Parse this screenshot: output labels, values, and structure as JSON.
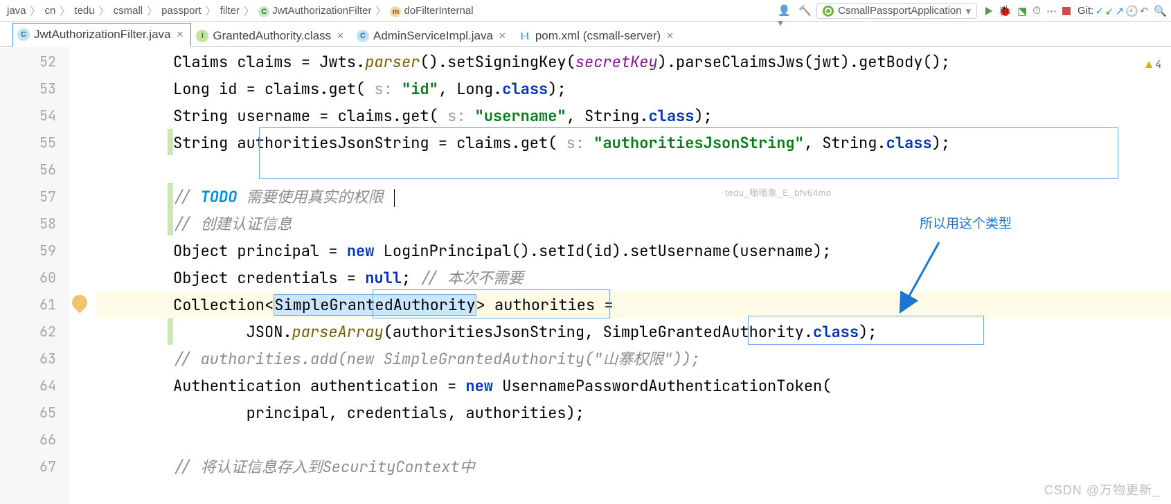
{
  "breadcrumbs": [
    "java",
    "cn",
    "tedu",
    "csmall",
    "passport",
    "filter",
    "JwtAuthorizationFilter",
    "doFilterInternal"
  ],
  "breadcrumb_icons": {
    "6": "C",
    "7": "m"
  },
  "run_config": "CsmallPassportApplication",
  "git_label": "Git:",
  "tabs": [
    {
      "icon": "C",
      "name": "JwtAuthorizationFilter.java",
      "active": true
    },
    {
      "icon": "I",
      "name": "GrantedAuthority.class",
      "active": false
    },
    {
      "icon": "C",
      "name": "AdminServiceImpl.java",
      "active": false
    },
    {
      "icon": "m",
      "name": "pom.xml (csmall-server)",
      "active": false
    }
  ],
  "warn_count": "4",
  "line_start": 52,
  "code_lines": [
    [
      {
        "t": "Claims claims = Jwts.",
        "c": "k-type"
      },
      {
        "t": "parser",
        "c": "k-method"
      },
      {
        "t": "().setSigningKey(",
        "c": "k-type"
      },
      {
        "t": "secretKey",
        "c": "k-field"
      },
      {
        "t": ").parseClaimsJws(jwt).getBody();",
        "c": "k-type"
      }
    ],
    [
      {
        "t": "Long id = claims.get(",
        "c": "k-type"
      },
      {
        "t": " s: ",
        "c": "k-param"
      },
      {
        "t": "\"id\"",
        "c": "k-str"
      },
      {
        "t": ", Long.",
        "c": "k-type"
      },
      {
        "t": "class",
        "c": "k-dotclass"
      },
      {
        "t": ");",
        "c": "k-type"
      }
    ],
    [
      {
        "t": "String username = claims.get(",
        "c": "k-type"
      },
      {
        "t": " s: ",
        "c": "k-param"
      },
      {
        "t": "\"username\"",
        "c": "k-str"
      },
      {
        "t": ", String.",
        "c": "k-type"
      },
      {
        "t": "class",
        "c": "k-dotclass"
      },
      {
        "t": ");",
        "c": "k-type"
      }
    ],
    [
      {
        "t": "String authoritiesJsonString = claims.get(",
        "c": "k-type"
      },
      {
        "t": " s: ",
        "c": "k-param"
      },
      {
        "t": "\"authoritiesJsonString\"",
        "c": "k-str"
      },
      {
        "t": ", String.",
        "c": "k-type"
      },
      {
        "t": "class",
        "c": "k-dotclass"
      },
      {
        "t": ");",
        "c": "k-type"
      }
    ],
    [],
    [
      {
        "t": "// ",
        "c": "k-comment"
      },
      {
        "t": "TODO",
        "c": "k-todo"
      },
      {
        "t": " 需要使用真实的权限",
        "c": "k-comment"
      }
    ],
    [
      {
        "t": "// 创建认证信息",
        "c": "k-comment"
      }
    ],
    [
      {
        "t": "Object principal = ",
        "c": "k-type"
      },
      {
        "t": "new",
        "c": "k-kw"
      },
      {
        "t": " LoginPrincipal().setId(id).setUsername(username);",
        "c": "k-type"
      }
    ],
    [
      {
        "t": "Object credentials = ",
        "c": "k-type"
      },
      {
        "t": "null",
        "c": "k-kw"
      },
      {
        "t": "; ",
        "c": "k-type"
      },
      {
        "t": "// 本次不需要",
        "c": "k-comment"
      }
    ],
    [
      {
        "t": "Collection<",
        "c": "k-type"
      },
      {
        "t": "SimpleGrantedAuthority",
        "c": "k-type sel"
      },
      {
        "t": "> authorities =",
        "c": "k-type"
      }
    ],
    [
      {
        "t": "        JSON.",
        "c": "k-type"
      },
      {
        "t": "parseArray",
        "c": "k-method"
      },
      {
        "t": "(authoritiesJsonString, ",
        "c": "k-type"
      },
      {
        "t": "SimpleGrantedAuthority",
        "c": "k-type"
      },
      {
        "t": ".",
        "c": "k-type"
      },
      {
        "t": "class",
        "c": "k-dotclass"
      },
      {
        "t": ");",
        "c": "k-type"
      }
    ],
    [
      {
        "t": "// authorities.add(new SimpleGrantedAuthority(\"山寨权限\"));",
        "c": "k-comment"
      }
    ],
    [
      {
        "t": "Authentication authentication = ",
        "c": "k-type"
      },
      {
        "t": "new",
        "c": "k-kw"
      },
      {
        "t": " UsernamePasswordAuthenticationToken(",
        "c": "k-type"
      }
    ],
    [
      {
        "t": "        principal, credentials, authorities);",
        "c": "k-type"
      }
    ],
    [],
    [
      {
        "t": "// 将认证信息存入到SecurityContext中",
        "c": "k-comment"
      }
    ]
  ],
  "annotation_text": "所以用这个类型",
  "watermark": "tedu_嗡嗡象_E_bfv64mo",
  "csdn": "CSDN @万物更新_"
}
